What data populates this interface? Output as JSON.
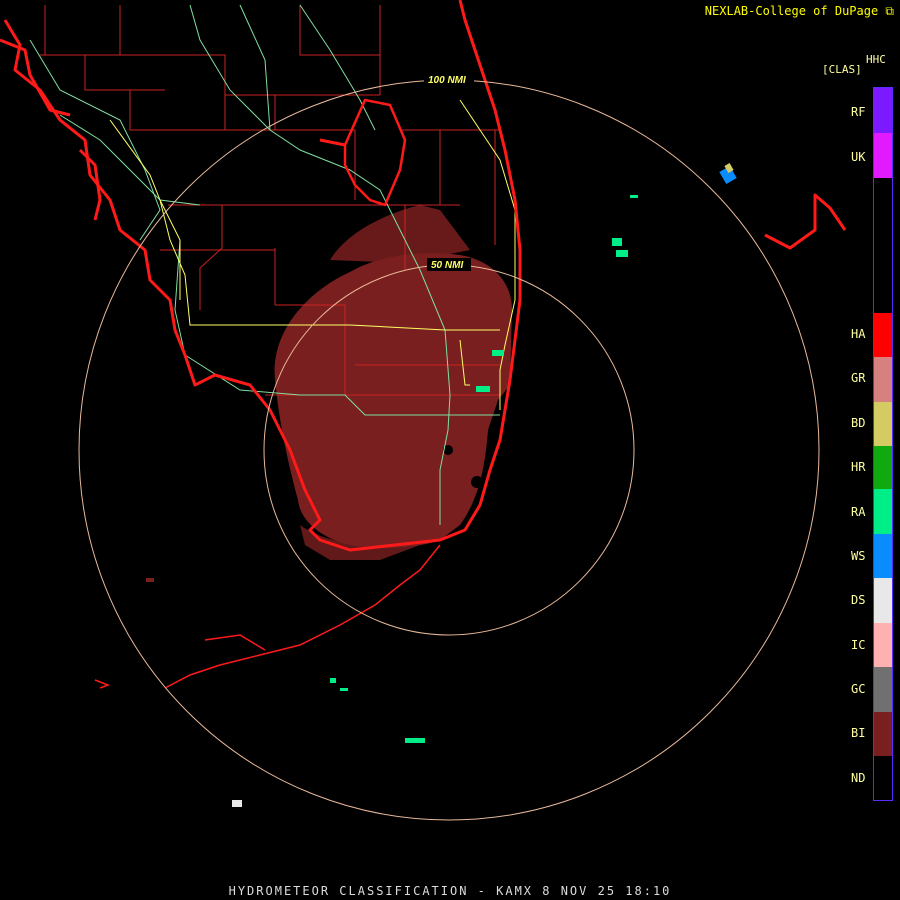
{
  "header": {
    "credit": "NEXLAB-College of DuPage",
    "credit_icon": "link-arrow-icon"
  },
  "range_rings": [
    {
      "label": "100 NMI"
    },
    {
      "label": "50 NMI"
    }
  ],
  "legend": {
    "product": "HHC",
    "units": "[CLAS]",
    "classes": [
      {
        "code": "RF",
        "color": "#7b19ff"
      },
      {
        "code": "UK",
        "color": "#e11aff"
      },
      {
        "code": "HA",
        "color": "#ff0000"
      },
      {
        "code": "GR",
        "color": "#d68080"
      },
      {
        "code": "BD",
        "color": "#d4cc62"
      },
      {
        "code": "HR",
        "color": "#10aa10"
      },
      {
        "code": "RA",
        "color": "#00ee88"
      },
      {
        "code": "WS",
        "color": "#0a8cff"
      },
      {
        "code": "DS",
        "color": "#e8e8e8"
      },
      {
        "code": "IC",
        "color": "#ffb0b0"
      },
      {
        "code": "GC",
        "color": "#707070"
      },
      {
        "code": "BI",
        "color": "#7a1f1f"
      },
      {
        "code": "ND",
        "color": "#000000"
      }
    ]
  },
  "footer": {
    "title": "HYDROMETEOR CLASSIFICATION - KAMX 8 NOV 25 18:10"
  },
  "colors": {
    "coast": "#ff1a1a",
    "county": "#cc2222",
    "highway": "#7fdf9f",
    "interstate": "#ffff66",
    "ring": "#e8b99a",
    "bi_echo": "#7a1f1f",
    "ra_echo": "#00ee88"
  }
}
